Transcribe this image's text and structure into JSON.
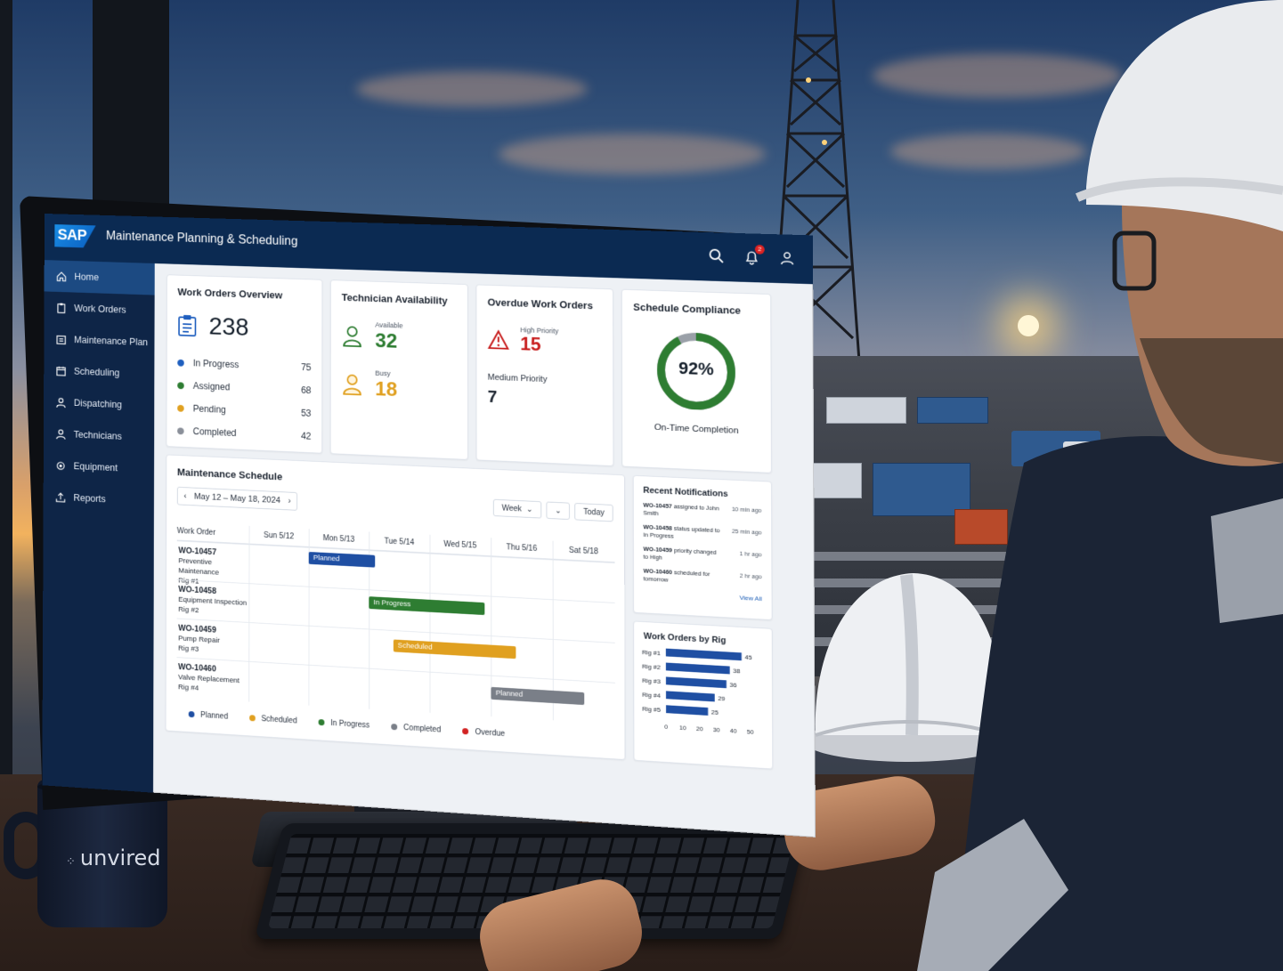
{
  "app": {
    "logo": "SAP",
    "title": "Maintenance Planning & Scheduling",
    "notification_count": "2"
  },
  "sidebar": {
    "items": [
      {
        "label": "Home",
        "icon": "home-icon",
        "active": true
      },
      {
        "label": "Work Orders",
        "icon": "clipboard-icon"
      },
      {
        "label": "Maintenance Plan",
        "icon": "calendar-list-icon"
      },
      {
        "label": "Scheduling",
        "icon": "calendar-icon"
      },
      {
        "label": "Dispatching",
        "icon": "person-dispatch-icon"
      },
      {
        "label": "Technicians",
        "icon": "person-icon"
      },
      {
        "label": "Equipment",
        "icon": "gear-cube-icon"
      },
      {
        "label": "Reports",
        "icon": "upload-report-icon"
      }
    ]
  },
  "work_orders_overview": {
    "title": "Work Orders Overview",
    "total": "238",
    "statuses": [
      {
        "label": "In Progress",
        "count": "75",
        "color": "#1f5fbf"
      },
      {
        "label": "Assigned",
        "count": "68",
        "color": "#2e7d32"
      },
      {
        "label": "Pending",
        "count": "53",
        "color": "#e0a020"
      },
      {
        "label": "Completed",
        "count": "42",
        "color": "#8a8f99"
      }
    ]
  },
  "technician_availability": {
    "title": "Technician Availability",
    "available_label": "Available",
    "available": "32",
    "busy_label": "Busy",
    "busy": "18"
  },
  "overdue_work_orders": {
    "title": "Overdue Work Orders",
    "high_label": "High Priority",
    "high": "15",
    "medium_label": "Medium Priority",
    "medium": "7"
  },
  "schedule_compliance": {
    "title": "Schedule Compliance",
    "percent": 92,
    "percent_label": "92%",
    "caption": "On-Time Completion"
  },
  "maintenance_schedule": {
    "title": "Maintenance Schedule",
    "date_range": "May 12 – May 18, 2024",
    "view": "Week",
    "today": "Today",
    "column_header": "Work Order",
    "days": [
      "Sun 5/12",
      "Mon 5/13",
      "Tue 5/14",
      "Wed 5/15",
      "Thu 5/16",
      "Sat 5/18"
    ],
    "rows": [
      {
        "id": "WO-10457",
        "desc": "Preventive Maintenance",
        "rig": "Rig #1",
        "status": "Planned",
        "start_day": 1,
        "span": 1.1
      },
      {
        "id": "WO-10458",
        "desc": "Equipment Inspection",
        "rig": "Rig #2",
        "status": "In Progress",
        "start_day": 2,
        "span": 1.9
      },
      {
        "id": "WO-10459",
        "desc": "Pump Repair",
        "rig": "Rig #3",
        "status": "Scheduled",
        "start_day": 2.4,
        "span": 2
      },
      {
        "id": "WO-10460",
        "desc": "Valve Replacement",
        "rig": "Rig #4",
        "status": "Planned",
        "start_day": 4,
        "span": 1.5
      }
    ],
    "legend": [
      {
        "label": "Planned",
        "color": "#1f4fa3"
      },
      {
        "label": "Scheduled",
        "color": "#e0a020"
      },
      {
        "label": "In Progress",
        "color": "#2e7d32"
      },
      {
        "label": "Completed",
        "color": "#7a7f88"
      },
      {
        "label": "Overdue",
        "color": "#d22222"
      }
    ]
  },
  "recent_notifications": {
    "title": "Recent Notifications",
    "items": [
      {
        "id": "WO-10457",
        "text": "assigned to John Smith",
        "ago": "10 min ago"
      },
      {
        "id": "WO-10458",
        "text": "status updated to In Progress",
        "ago": "25 min ago"
      },
      {
        "id": "WO-10459",
        "text": "priority changed to High",
        "ago": "1 hr ago"
      },
      {
        "id": "WO-10460",
        "text": "scheduled for tomorrow",
        "ago": "2 hr ago"
      }
    ],
    "view_all": "View All"
  },
  "chart_data": {
    "type": "bar",
    "orientation": "horizontal",
    "title": "Work Orders by Rig",
    "categories": [
      "Rig #1",
      "Rig #2",
      "Rig #3",
      "Rig #4",
      "Rig #5"
    ],
    "values": [
      45,
      38,
      36,
      29,
      25
    ],
    "xlim": [
      0,
      50
    ],
    "ticks": [
      0,
      10,
      20,
      30,
      40,
      50
    ],
    "color": "#1f4fa3",
    "grid": false
  },
  "mug": {
    "brand": "unvired"
  }
}
